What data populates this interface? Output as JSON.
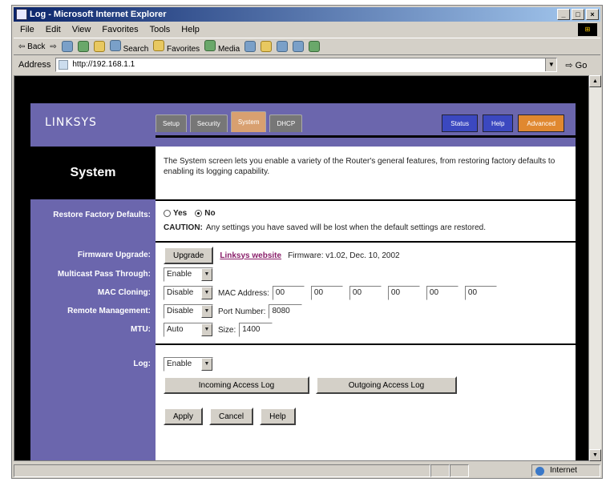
{
  "browser": {
    "title": "Log - Microsoft Internet Explorer",
    "menu": [
      "File",
      "Edit",
      "View",
      "Favorites",
      "Tools",
      "Help"
    ],
    "toolbar": {
      "back": "Back",
      "search": "Search",
      "favorites": "Favorites",
      "media": "Media"
    },
    "address_label": "Address",
    "address_value": "http://192.168.1.1",
    "go_label": "Go",
    "zone": "Internet"
  },
  "router": {
    "logo": "LINKSYS",
    "tabs": [
      "Setup",
      "Security",
      "System",
      "DHCP"
    ],
    "right_tabs": [
      "Status",
      "Help",
      "Advanced"
    ],
    "section_title": "System",
    "description": "The System screen lets you enable a variety of the Router's general features, from restoring factory defaults to enabling its logging capability.",
    "restore": {
      "label": "Restore Factory Defaults:",
      "yes": "Yes",
      "no": "No",
      "selected": "No",
      "caution_bold": "CAUTION:",
      "caution_text": "Any settings you have saved will be lost when the default settings are restored."
    },
    "firmware": {
      "label": "Firmware Upgrade:",
      "button": "Upgrade",
      "link": "Linksys website",
      "version": "Firmware: v1.02, Dec. 10, 2002"
    },
    "multicast": {
      "label": "Multicast Pass Through:",
      "value": "Enable"
    },
    "mac_cloning": {
      "label": "MAC Cloning:",
      "value": "Disable",
      "address_label": "MAC Address:",
      "octets": [
        "00",
        "00",
        "00",
        "00",
        "00",
        "00"
      ]
    },
    "remote": {
      "label": "Remote Management:",
      "value": "Disable",
      "port_label": "Port Number:",
      "port": "8080"
    },
    "mtu": {
      "label": "MTU:",
      "value": "Auto",
      "size_label": "Size:",
      "size": "1400"
    },
    "log": {
      "label": "Log:",
      "value": "Enable",
      "incoming": "Incoming Access Log",
      "outgoing": "Outgoing Access Log"
    },
    "buttons": {
      "apply": "Apply",
      "cancel": "Cancel",
      "help": "Help"
    }
  }
}
